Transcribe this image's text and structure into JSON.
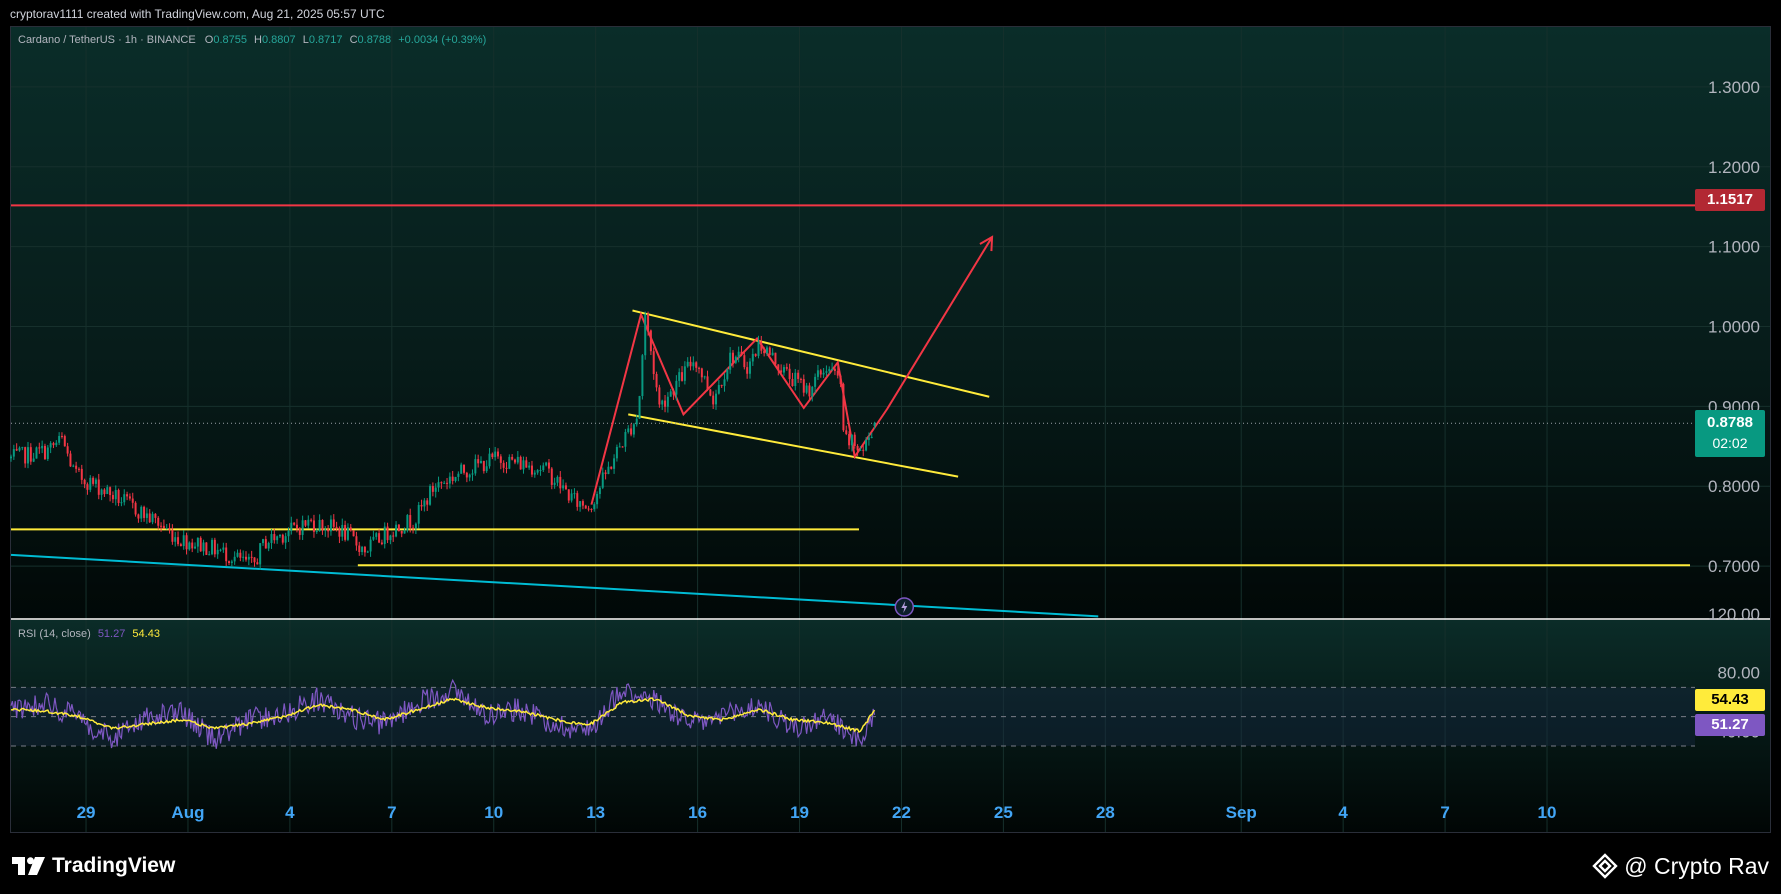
{
  "header": {
    "caption": "cryptorav1111 created with TradingView.com, Aug 21, 2025 05:57 UTC"
  },
  "legend": {
    "symbol": "Cardano / TetherUS · 1h · BINANCE",
    "o_label": "O",
    "o": "0.8755",
    "h_label": "H",
    "h": "0.8807",
    "l_label": "L",
    "l": "0.8717",
    "c_label": "C",
    "c": "0.8788",
    "change": "+0.0034 (+0.39%)"
  },
  "rsi_legend": {
    "title": "RSI (14, close)",
    "rsi_value": "51.27",
    "ma_value": "54.43"
  },
  "price_labels": {
    "resistance": "1.1517",
    "last_price": "0.8788",
    "countdown": "02:02",
    "rsi_ma": "54.43",
    "rsi": "51.27"
  },
  "footer": {
    "brand": "TradingView",
    "watermark": "@ Crypto Rav"
  },
  "colors": {
    "background": "#000000",
    "candle_up": "#089981",
    "candle_down": "#f23645",
    "resistance_line": "#f23645",
    "trendline": "#ffeb3b",
    "long_trendline": "#00bcd4",
    "pattern_path": "#f23645",
    "rsi_line": "#7e57c2",
    "rsi_ma_line": "#ffeb3b",
    "axis_text": "#b2b5be",
    "date_text": "#42a5f5"
  },
  "chart_data": [
    {
      "type": "candlestick",
      "title": "Cardano / TetherUS · 1h · BINANCE",
      "y_axis": {
        "ticks": [
          "1.3000",
          "1.2000",
          "1.1000",
          "1.0000",
          "0.9000",
          "0.8000",
          "0.7000"
        ],
        "ylim": [
          0.635,
          1.375
        ]
      },
      "x_axis": {
        "ticks": [
          "29",
          "Aug",
          "4",
          "7",
          "10",
          "13",
          "16",
          "19",
          "22",
          "25",
          "28",
          "Sep",
          "4",
          "7",
          "10"
        ],
        "tick_dates": [
          "2025-07-29",
          "2025-08-01",
          "2025-08-04",
          "2025-08-07",
          "2025-08-10",
          "2025-08-13",
          "2025-08-16",
          "2025-08-19",
          "2025-08-22",
          "2025-08-25",
          "2025-08-28",
          "2025-09-01",
          "2025-09-04",
          "2025-09-07",
          "2025-09-10"
        ],
        "xlim": [
          "2025-07-26 19:00",
          "2025-09-14 05:00"
        ]
      },
      "price_path": {
        "date": [
          "2025-07-26 19:00",
          "2025-07-27 21:00",
          "2025-07-28 07:00",
          "2025-07-28 16:00",
          "2025-07-29 10:00",
          "2025-07-30 08:00",
          "2025-07-31 02:00",
          "2025-07-31 17:00",
          "2025-08-01 21:00",
          "2025-08-02 22:00",
          "2025-08-03 06:00",
          "2025-08-04 14:00",
          "2025-08-05 12:00",
          "2025-08-06 05:00",
          "2025-08-06 23:00",
          "2025-08-07 17:00",
          "2025-08-08 06:00",
          "2025-08-09 04:00",
          "2025-08-10 02:00",
          "2025-08-11 12:00",
          "2025-08-12 10:00",
          "2025-08-12 20:00",
          "2025-08-13 17:00",
          "2025-08-14 06:00",
          "2025-08-14 11:00",
          "2025-08-14 21:00",
          "2025-08-15 22:00",
          "2025-08-16 11:00",
          "2025-08-17 00:00",
          "2025-08-17 12:00",
          "2025-08-17 20:00",
          "2025-08-18 15:00",
          "2025-08-19 06:00",
          "2025-08-19 19:00",
          "2025-08-20 05:00",
          "2025-08-20 07:00",
          "2025-08-20 21:00",
          "2025-08-21 05:00"
        ],
        "close": [
          0.835,
          0.845,
          0.858,
          0.815,
          0.798,
          0.775,
          0.755,
          0.735,
          0.72,
          0.7,
          0.73,
          0.755,
          0.745,
          0.72,
          0.745,
          0.76,
          0.8,
          0.82,
          0.835,
          0.822,
          0.78,
          0.775,
          0.85,
          0.89,
          1.015,
          0.9,
          0.96,
          0.91,
          0.965,
          0.95,
          0.98,
          0.94,
          0.92,
          0.95,
          0.93,
          0.86,
          0.845,
          0.879
        ]
      },
      "last": {
        "date": "2025-08-21 05:00",
        "open": 0.8755,
        "high": 0.8807,
        "low": 0.8717,
        "close": 0.8788,
        "change": 0.0034,
        "change_pct": 0.39
      },
      "horizontal_lines": [
        {
          "name": "resistance",
          "price": 1.1517
        },
        {
          "name": "support-short",
          "price": 0.746,
          "from": "2025-07-26 19:00",
          "to": "2025-08-20 18:00"
        },
        {
          "name": "support-long",
          "price": 0.701,
          "from": "2025-08-06 00:00",
          "to": "2025-09-14 05:00"
        }
      ],
      "trendlines": [
        {
          "name": "channel-upper",
          "from": {
            "date": "2025-08-14 02:00",
            "price": 1.02
          },
          "to": {
            "date": "2025-08-24 14:00",
            "price": 0.912
          }
        },
        {
          "name": "channel-lower",
          "from": {
            "date": "2025-08-13 23:00",
            "price": 0.89
          },
          "to": {
            "date": "2025-08-23 16:00",
            "price": 0.812
          }
        },
        {
          "name": "long-support",
          "from": {
            "date": "2025-07-26 19:00",
            "price": 0.714
          },
          "to": {
            "date": "2025-08-27 19:00",
            "price": 0.637
          }
        }
      ],
      "projection_path": {
        "date": [
          "2025-08-12 21:00",
          "2025-08-14 08:00",
          "2025-08-15 14:00",
          "2025-08-17 18:00",
          "2025-08-19 03:00",
          "2025-08-20 03:00",
          "2025-08-20 15:00",
          "2025-08-21 14:00",
          "2025-08-24 16:00"
        ],
        "price": [
          0.777,
          1.015,
          0.89,
          0.985,
          0.898,
          0.955,
          0.837,
          0.897,
          1.112
        ]
      }
    },
    {
      "type": "line",
      "title": "RSI (14, close)",
      "y_axis": {
        "ticks": [
          "120.00",
          "80.00",
          "40.00"
        ],
        "ylim": [
          0,
          120
        ],
        "bands": [
          30,
          70
        ],
        "midline": 50
      },
      "series": [
        {
          "name": "RSI",
          "last": 51.27
        },
        {
          "name": "MA",
          "last": 54.43
        }
      ],
      "rsi_path": {
        "date": [
          "2025-07-26 19:00",
          "2025-07-27 19:00",
          "2025-07-28 19:00",
          "2025-07-29 19:00",
          "2025-07-30 19:00",
          "2025-07-31 19:00",
          "2025-08-01 19:00",
          "2025-08-02 19:00",
          "2025-08-03 19:00",
          "2025-08-04 19:00",
          "2025-08-05 19:00",
          "2025-08-06 19:00",
          "2025-08-07 19:00",
          "2025-08-08 19:00",
          "2025-08-09 19:00",
          "2025-08-10 19:00",
          "2025-08-11 19:00",
          "2025-08-12 19:00",
          "2025-08-13 19:00",
          "2025-08-14 19:00",
          "2025-08-15 19:00",
          "2025-08-16 19:00",
          "2025-08-17 19:00",
          "2025-08-18 19:00",
          "2025-08-19 19:00",
          "2025-08-20 19:00",
          "2025-08-21 05:00"
        ],
        "rsi": [
          55,
          60,
          48,
          35,
          50,
          52,
          35,
          48,
          52,
          62,
          50,
          45,
          60,
          68,
          52,
          55,
          45,
          40,
          70,
          60,
          45,
          50,
          58,
          42,
          48,
          35,
          51.27
        ],
        "ma": [
          55,
          54,
          50,
          42,
          45,
          48,
          42,
          45,
          50,
          58,
          55,
          48,
          55,
          62,
          56,
          54,
          48,
          44,
          60,
          62,
          50,
          48,
          55,
          48,
          46,
          40,
          54.43
        ]
      }
    }
  ]
}
